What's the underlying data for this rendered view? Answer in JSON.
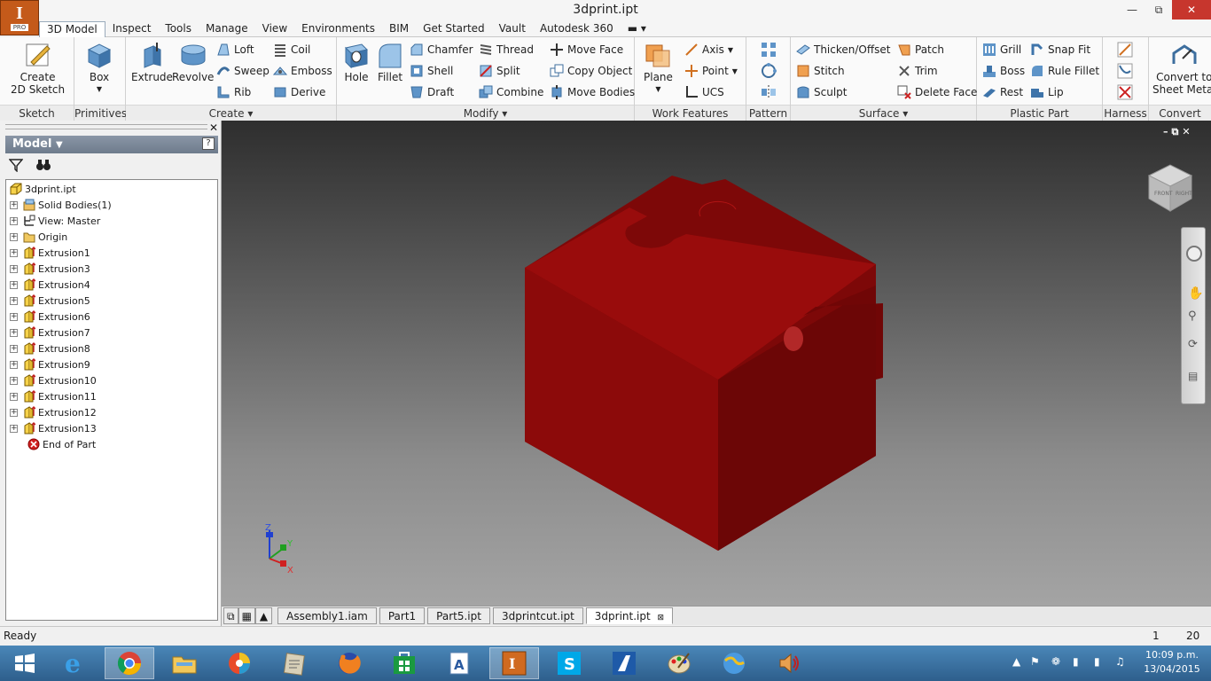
{
  "window": {
    "title": "3dprint.ipt",
    "app_badge": "I",
    "app_badge_sub": "PRO"
  },
  "menu_tabs": [
    "3D Model",
    "Inspect",
    "Tools",
    "Manage",
    "View",
    "Environments",
    "BIM",
    "Get Started",
    "Vault",
    "Autodesk 360"
  ],
  "ribbon": {
    "sketch": {
      "label": "Sketch",
      "create": "Create",
      "sketch2d": "2D Sketch"
    },
    "primitives": {
      "label": "Primitives",
      "box": "Box"
    },
    "create": {
      "label": "Create",
      "extrude": "Extrude",
      "revolve": "Revolve",
      "loft": "Loft",
      "sweep": "Sweep",
      "rib": "Rib",
      "coil": "Coil",
      "emboss": "Emboss",
      "derive": "Derive"
    },
    "modify": {
      "label": "Modify",
      "hole": "Hole",
      "fillet": "Fillet",
      "chamfer": "Chamfer",
      "shell": "Shell",
      "draft": "Draft",
      "thread": "Thread",
      "split": "Split",
      "combine": "Combine",
      "move_face": "Move Face",
      "copy_object": "Copy Object",
      "move_bodies": "Move Bodies"
    },
    "work_features": {
      "label": "Work Features",
      "plane": "Plane",
      "axis": "Axis",
      "point": "Point",
      "ucs": "UCS"
    },
    "pattern": {
      "label": "Pattern"
    },
    "surface": {
      "label": "Surface",
      "thicken": "Thicken/Offset",
      "stitch": "Stitch",
      "sculpt": "Sculpt",
      "patch": "Patch",
      "trim": "Trim",
      "delete_face": "Delete Face"
    },
    "plastic": {
      "label": "Plastic Part",
      "grill": "Grill",
      "boss": "Boss",
      "rest": "Rest",
      "snap_fit": "Snap Fit",
      "rule_fillet": "Rule Fillet",
      "lip": "Lip"
    },
    "harness": {
      "label": "Harness"
    },
    "convert": {
      "label": "Convert",
      "line1": "Convert to",
      "line2": "Sheet Metal"
    }
  },
  "browser": {
    "title": "Model",
    "items": [
      {
        "label": "3dprint.ipt",
        "icon": "part-icon"
      },
      {
        "label": "Solid Bodies(1)",
        "icon": "solid-bodies-icon"
      },
      {
        "label": "View: Master",
        "icon": "view-icon"
      },
      {
        "label": "Origin",
        "icon": "folder-icon"
      },
      {
        "label": "Extrusion1",
        "icon": "extrusion-icon"
      },
      {
        "label": "Extrusion3",
        "icon": "extrusion-icon"
      },
      {
        "label": "Extrusion4",
        "icon": "extrusion-icon"
      },
      {
        "label": "Extrusion5",
        "icon": "extrusion-icon"
      },
      {
        "label": "Extrusion6",
        "icon": "extrusion-icon"
      },
      {
        "label": "Extrusion7",
        "icon": "extrusion-icon"
      },
      {
        "label": "Extrusion8",
        "icon": "extrusion-icon"
      },
      {
        "label": "Extrusion9",
        "icon": "extrusion-icon"
      },
      {
        "label": "Extrusion10",
        "icon": "extrusion-icon"
      },
      {
        "label": "Extrusion11",
        "icon": "extrusion-icon"
      },
      {
        "label": "Extrusion12",
        "icon": "extrusion-icon"
      },
      {
        "label": "Extrusion13",
        "icon": "extrusion-icon"
      },
      {
        "label": "End of Part",
        "icon": "end-of-part-icon"
      }
    ]
  },
  "viewport": {
    "model_color": "#9b0c0c",
    "axes": {
      "x": "X",
      "y": "Y",
      "z": "Z"
    },
    "viewcube": {
      "front": "FRONT",
      "right": "RIGHT"
    }
  },
  "doc_tabs": [
    "Assembly1.iam",
    "Part1",
    "Part5.ipt",
    "3dprintcut.ipt",
    "3dprint.ipt"
  ],
  "status": {
    "text": "Ready",
    "count1": "1",
    "count2": "20"
  },
  "taskbar": {
    "time": "10:09 p.m.",
    "date": "13/04/2015"
  }
}
